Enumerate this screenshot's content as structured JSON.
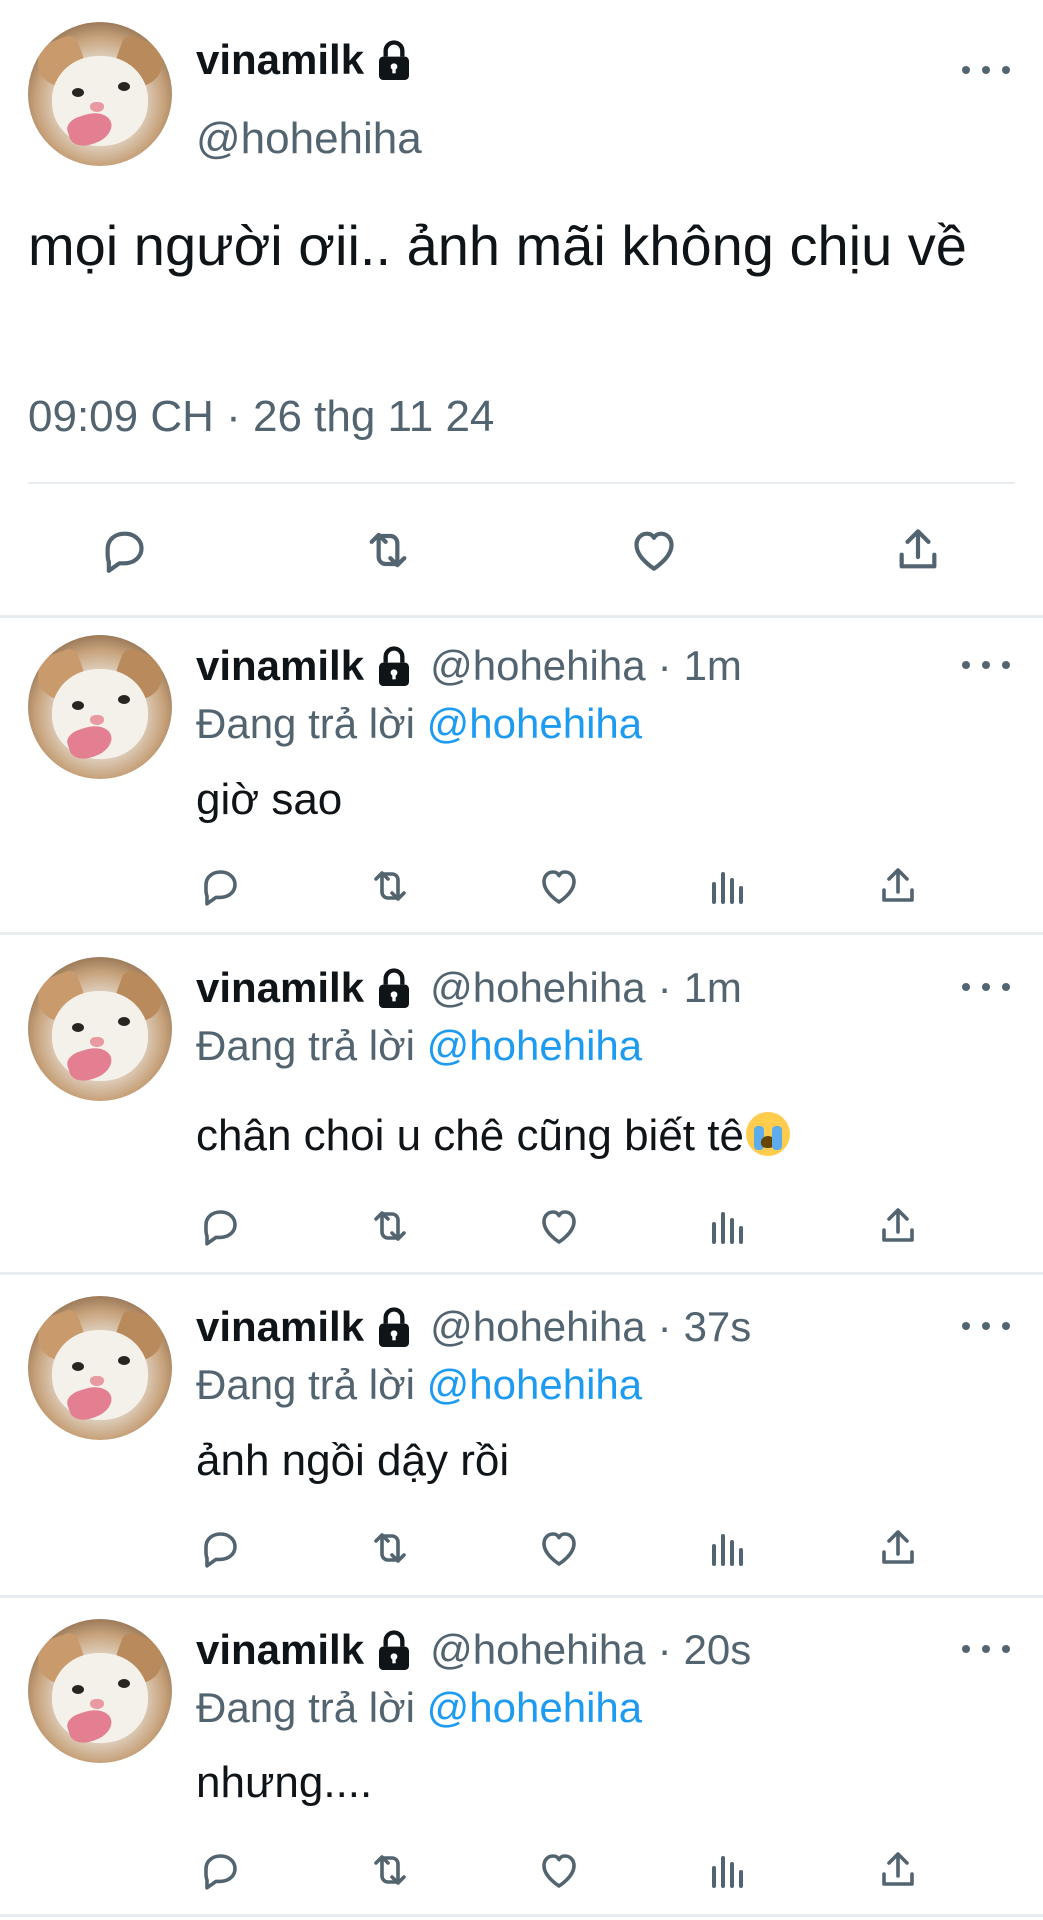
{
  "main_tweet": {
    "display_name": "vinamilk",
    "handle": "@hohehiha",
    "text": "mọi người ơii.. ảnh mãi không chịu về",
    "timestamp": "09:09 CH · 26 thg 11 24",
    "actions": [
      "reply-icon",
      "retweet-icon",
      "like-icon",
      "share-icon"
    ]
  },
  "replies": [
    {
      "display_name": "vinamilk",
      "handle": "@hohehiha",
      "separator": "·",
      "time": "1m",
      "replying_prefix": "Đang trả lời",
      "replying_to": "@hohehiha",
      "text": "giờ sao"
    },
    {
      "display_name": "vinamilk",
      "handle": "@hohehiha",
      "separator": "·",
      "time": "1m",
      "replying_prefix": "Đang trả lời",
      "replying_to": "@hohehiha",
      "text": "chân choi u chê cũng biết tê",
      "emoji": "loudly-crying-face"
    },
    {
      "display_name": "vinamilk",
      "handle": "@hohehiha",
      "separator": "·",
      "time": "37s",
      "replying_prefix": "Đang trả lời",
      "replying_to": "@hohehiha",
      "text": "ảnh ngồi dậy rồi"
    },
    {
      "display_name": "vinamilk",
      "handle": "@hohehiha",
      "separator": "·",
      "time": "20s",
      "replying_prefix": "Đang trả lời",
      "replying_to": "@hohehiha",
      "text": "nhưng...."
    }
  ],
  "colors": {
    "text": "#0f1419",
    "secondary": "#536471",
    "mention": "#1d9bf0",
    "divider": "#e6ecf0"
  }
}
